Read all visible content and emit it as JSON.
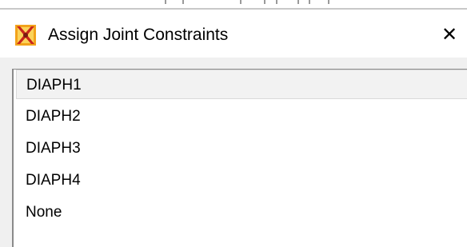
{
  "dialog": {
    "title": "Assign Joint Constraints",
    "close_label": "✕",
    "app_icon": "sap2000-app-icon"
  },
  "list": {
    "items": [
      {
        "label": "DIAPH1",
        "selected": true
      },
      {
        "label": "DIAPH2",
        "selected": false
      },
      {
        "label": "DIAPH3",
        "selected": false
      },
      {
        "label": "DIAPH4",
        "selected": false
      },
      {
        "label": "None",
        "selected": false
      }
    ]
  },
  "colors": {
    "titlebar": "#ffffff",
    "background": "#f0f0f0",
    "icon_primary": "#c9261b",
    "icon_secondary": "#f2a31b"
  }
}
